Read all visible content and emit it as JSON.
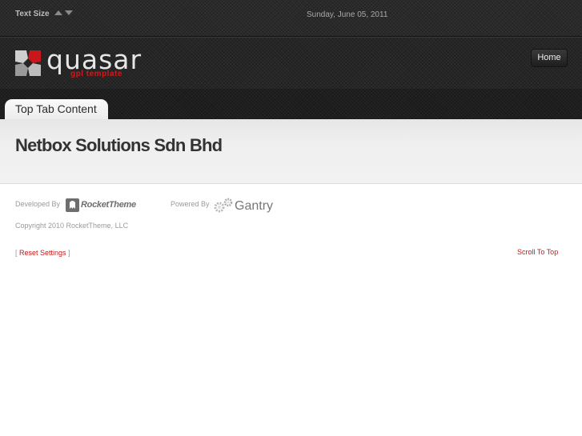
{
  "topbar": {
    "text_size_label": "Text Size",
    "date": "Sunday, June 05, 2011"
  },
  "header": {
    "logo_text": "quasar",
    "logo_subtext": "gpl template",
    "nav": [
      {
        "label": "Home"
      }
    ]
  },
  "tabs": [
    {
      "label": "Top Tab Content"
    }
  ],
  "main": {
    "title": "Netbox Solutions Sdn Bhd"
  },
  "footer": {
    "developed_by": "Developed By",
    "rocket_brand": "RocketTheme",
    "powered_by": "Powered By",
    "gantry_brand": "Gantry",
    "copyright": "Copyright 2010 RocketTheme, LLC",
    "reset_bracket_open": "[",
    "reset_label": "Reset Settings",
    "reset_bracket_close": "]",
    "scroll_top": "Scroll To Top"
  },
  "colors": {
    "accent": "#c8171a",
    "dark_bg": "#262626"
  }
}
